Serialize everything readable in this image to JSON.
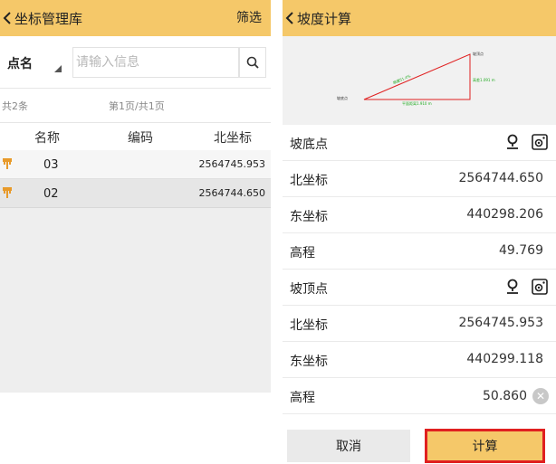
{
  "colors": {
    "accent": "#f5c869",
    "highlight": "#e02020",
    "pin": "#e89a2a",
    "list_bg": "#eeeeee"
  },
  "left": {
    "title": "坐标管理库",
    "filter_label": "筛选",
    "field_select": "点名",
    "search_placeholder": "请输入信息",
    "total": "共2条",
    "page": "第1页/共1页",
    "columns": [
      "名称",
      "编码",
      "北坐标"
    ],
    "rows": [
      {
        "name": "03",
        "north": "2564745.953"
      },
      {
        "name": "02",
        "north": "2564744.650"
      }
    ]
  },
  "right": {
    "title": "坡度计算",
    "diagram": {
      "top_label": "坡顶点",
      "bottom_label": "坡底点",
      "height_label": "高差1.091 m",
      "slope_label": "坡度51.4%",
      "horizontal_label": "平面距离1.910 m"
    },
    "fields": [
      {
        "label": "坡底点",
        "type": "point"
      },
      {
        "label": "北坐标",
        "value": "2564744.650"
      },
      {
        "label": "东坐标",
        "value": "440298.206"
      },
      {
        "label": "高程",
        "value": "49.769"
      },
      {
        "label": "坡顶点",
        "type": "point"
      },
      {
        "label": "北坐标",
        "value": "2564745.953"
      },
      {
        "label": "东坐标",
        "value": "440299.118"
      },
      {
        "label": "高程",
        "value": "50.860"
      }
    ],
    "cancel_label": "取消",
    "calc_label": "计算"
  }
}
